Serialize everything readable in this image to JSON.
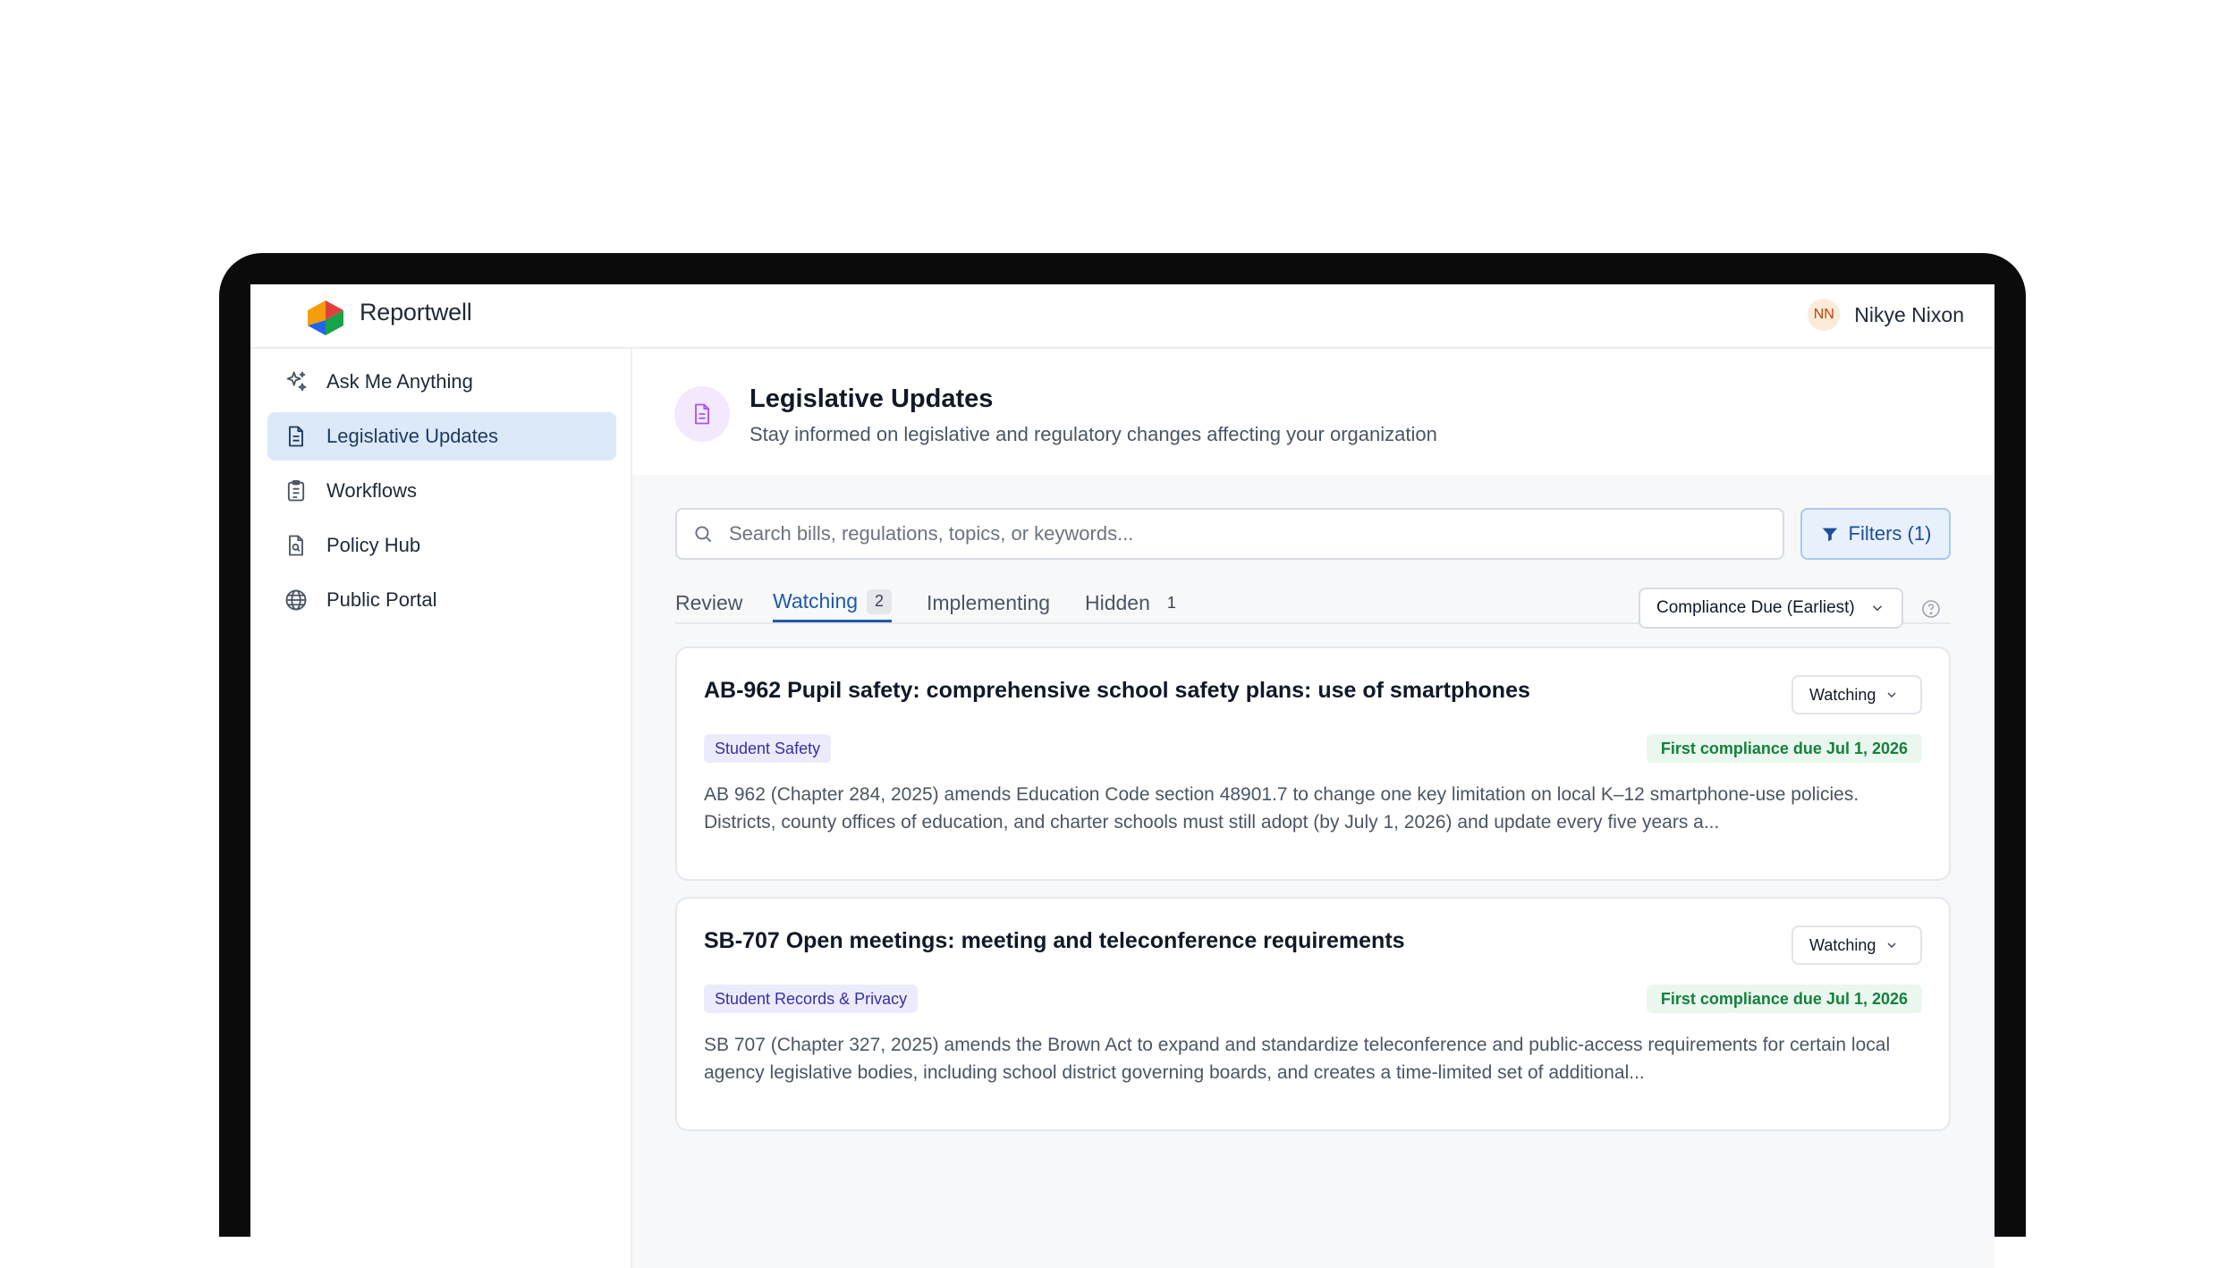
{
  "app": {
    "brand": "Reportwell"
  },
  "user": {
    "initials": "NN",
    "name": "Nikye Nixon"
  },
  "sidebar": {
    "items": [
      {
        "label": "Ask Me Anything",
        "icon": "sparkles-icon",
        "active": false
      },
      {
        "label": "Legislative Updates",
        "icon": "document-icon",
        "active": true
      },
      {
        "label": "Workflows",
        "icon": "clipboard-list-icon",
        "active": false
      },
      {
        "label": "Policy Hub",
        "icon": "file-search-icon",
        "active": false
      },
      {
        "label": "Public Portal",
        "icon": "globe-icon",
        "active": false
      }
    ]
  },
  "page": {
    "title": "Legislative Updates",
    "subtitle": "Stay informed on legislative and regulatory changes affecting your organization",
    "icon": "document-icon"
  },
  "search": {
    "placeholder": "Search bills, regulations, topics, or keywords...",
    "value": ""
  },
  "filters": {
    "label": "Filters (1)"
  },
  "tabs": [
    {
      "label": "Review",
      "count": "",
      "active": false
    },
    {
      "label": "Watching",
      "count": "2",
      "active": true
    },
    {
      "label": "Implementing",
      "count": "",
      "active": false
    },
    {
      "label": "Hidden",
      "count": "1",
      "active": false
    }
  ],
  "sort": {
    "selected": "Compliance Due (Earliest)"
  },
  "bills": [
    {
      "title": "AB-962 Pupil safety: comprehensive school safety plans: use of smartphones",
      "status": "Watching",
      "tag": "Student Safety",
      "due": "First compliance due Jul 1, 2026",
      "summary": "AB 962 (Chapter 284, 2025) amends Education Code section 48901.7 to change one key limitation on local K–12 smartphone-use policies. Districts, county offices of education, and charter schools must still adopt (by July 1, 2026) and update every five years a..."
    },
    {
      "title": "SB-707 Open meetings: meeting and teleconference requirements",
      "status": "Watching",
      "tag": "Student Records & Privacy",
      "due": "First compliance due Jul 1, 2026",
      "summary": "SB 707 (Chapter 327, 2025) amends the Brown Act to expand and standardize teleconference and public-access requirements for certain local agency legislative bodies, including school district governing boards, and creates a time-limited set of additional..."
    }
  ],
  "colors": {
    "accent": "#1e5aa8",
    "active_nav_bg": "#dbe9f8",
    "due_green": "#15803d",
    "tag_purple": "#3730a3"
  }
}
